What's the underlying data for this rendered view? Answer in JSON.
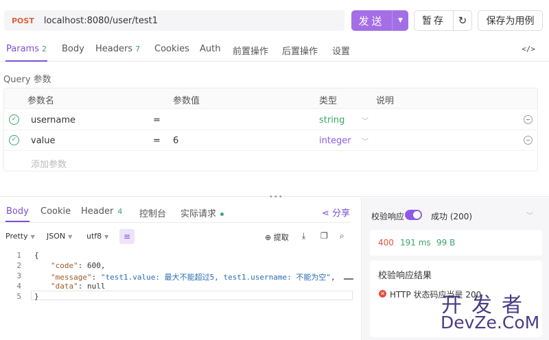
{
  "request": {
    "method": "POST",
    "url": "localhost:8080/user/test1",
    "send_label": "发送",
    "save_temp_label": "暂存",
    "save_case_label": "保存为用例"
  },
  "req_tabs": {
    "params": "Params",
    "params_count": "2",
    "body": "Body",
    "headers": "Headers",
    "headers_count": "7",
    "cookies": "Cookies",
    "auth": "Auth",
    "pre": "前置操作",
    "post": "后置操作",
    "settings": "设置"
  },
  "query": {
    "title": "Query 参数",
    "columns": {
      "name": "参数名",
      "value": "参数值",
      "type": "类型",
      "desc": "说明"
    },
    "rows": [
      {
        "name": "username",
        "eq": "=",
        "value": "",
        "type": "string"
      },
      {
        "name": "value",
        "eq": "=",
        "value": "6",
        "type": "integer"
      }
    ],
    "add_placeholder": "添加参数"
  },
  "resp_tabs": {
    "body": "Body",
    "cookie": "Cookie",
    "header": "Header",
    "header_count": "4",
    "console": "控制台",
    "actual": "实际请求",
    "share": "分享"
  },
  "toolbar": {
    "format": "Pretty",
    "lang": "JSON",
    "encoding": "utf8",
    "extract": "提取"
  },
  "code_lines": [
    {
      "n": "1",
      "t": "{"
    },
    {
      "n": "2",
      "t": "\"code\": 600,"
    },
    {
      "n": "3",
      "t": "\"message\": \"test1.value: 最大不能超过5, test1.username: 不能为空\","
    },
    {
      "n": "4",
      "t": "\"data\": null"
    },
    {
      "n": "5",
      "t": "}"
    }
  ],
  "right_panel": {
    "validate_label": "校验响应",
    "success_label": "成功 (200)",
    "status": "400",
    "time": "191 ms",
    "size": "99 B",
    "result_title": "校验响应结果",
    "error_text": "HTTP 状态码应当是 200"
  },
  "watermark": {
    "line1": "开发者",
    "line2": "DevZe.CoM"
  },
  "colors": {
    "accent": "#7b4fd6",
    "send_bg": "#a46fe6",
    "method": "#e0613a",
    "success": "#3aa56b",
    "error": "#e0503a"
  }
}
